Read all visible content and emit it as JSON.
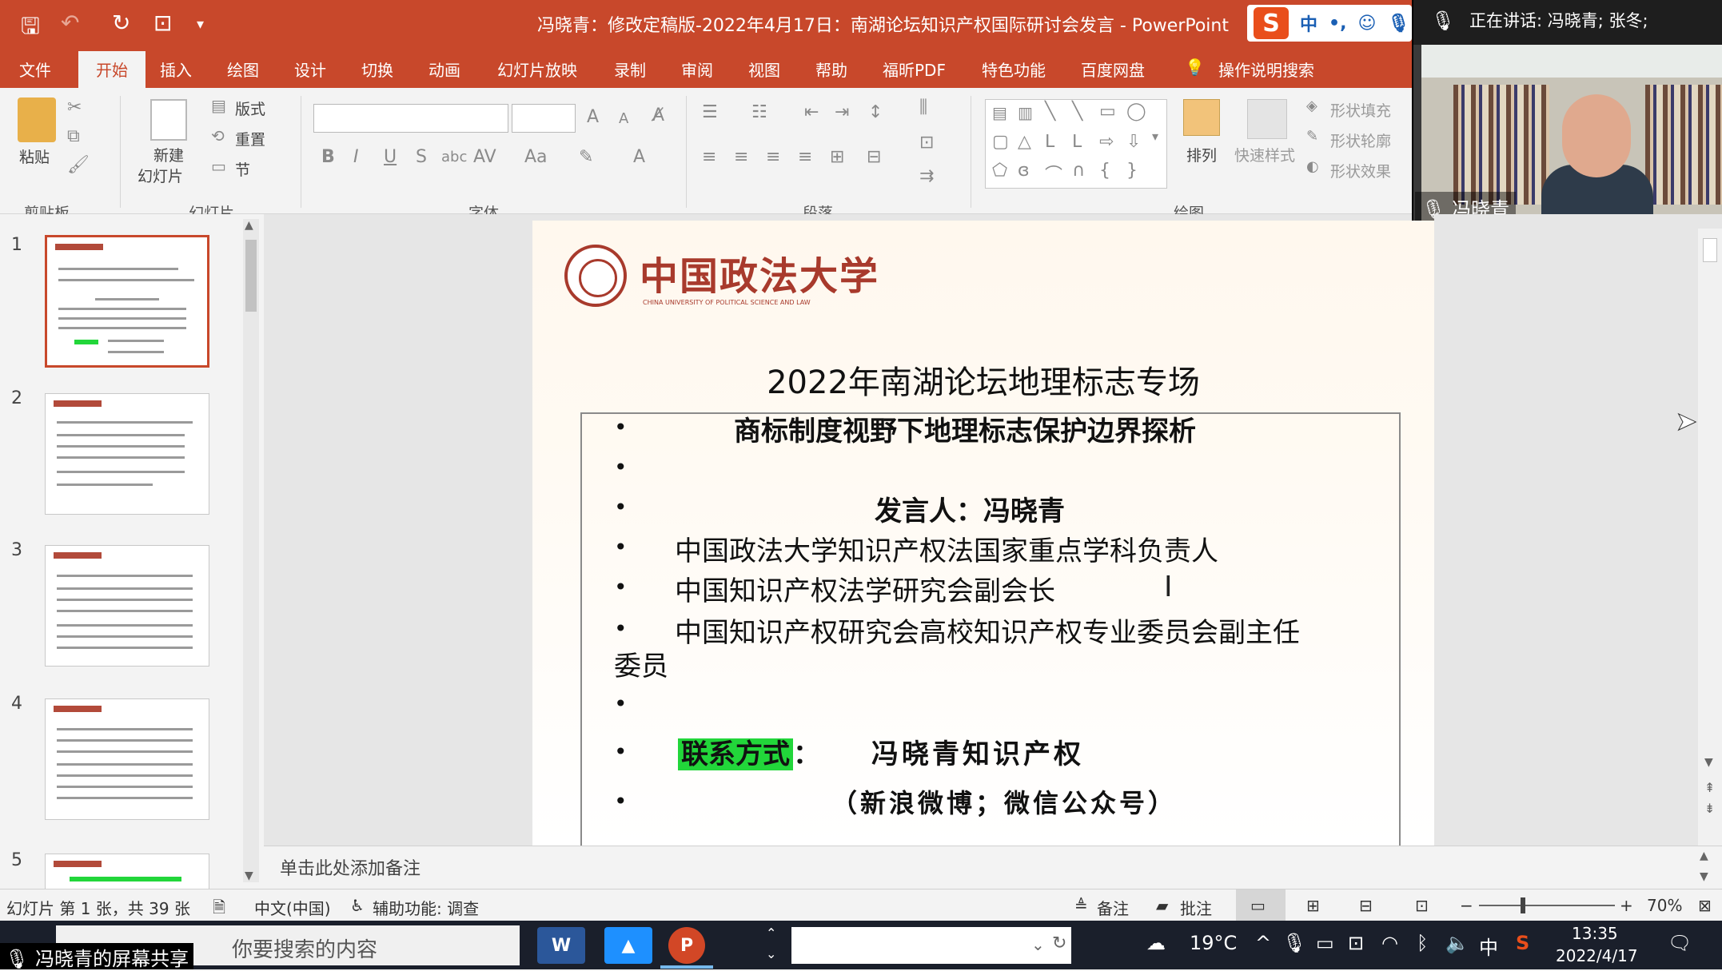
{
  "window": {
    "title": "冯晓青：修改定稿版-2022年4月17日：南湖论坛知识产权国际研讨会发言 - PowerPoint"
  },
  "tabs": [
    "文件",
    "开始",
    "插入",
    "绘图",
    "设计",
    "切换",
    "动画",
    "幻灯片放映",
    "录制",
    "审阅",
    "视图",
    "帮助",
    "福昕PDF",
    "特色功能",
    "百度网盘"
  ],
  "active_tab": "开始",
  "tell_me": "操作说明搜索",
  "ime": {
    "mode": "中"
  },
  "ribbon": {
    "clipboard": {
      "paste": "粘贴",
      "group": "剪贴板"
    },
    "slides": {
      "new_slide_1": "新建",
      "new_slide_2": "幻灯片",
      "layout": "版式",
      "reset": "重置",
      "section": "节",
      "group": "幻灯片"
    },
    "font": {
      "group": "字体"
    },
    "paragraph": {
      "group": "段落"
    },
    "drawing": {
      "arrange": "排列",
      "quick_styles": "快速样式",
      "shape_fill": "形状填充",
      "shape_outline": "形状轮廓",
      "shape_effects": "形状效果",
      "group": "绘图"
    }
  },
  "video": {
    "speaking": "正在讲话: 冯晓青; 张冬;",
    "name": "冯晓青"
  },
  "thumbnails": [
    {
      "num": "1"
    },
    {
      "num": "2"
    },
    {
      "num": "3"
    },
    {
      "num": "4"
    },
    {
      "num": "5"
    }
  ],
  "slide": {
    "logo_cn": "中国政法大学",
    "logo_en": "CHINA UNIVERSITY OF POLITICAL SCIENCE AND LAW",
    "title": "2022年南湖论坛地理标志专场",
    "subtitle": "商标制度视野下地理标志保护边界探析",
    "speaker": "发言人：冯晓青",
    "role1": "中国政法大学知识产权法国家重点学科负责人",
    "role2": "中国知识产权法学研究会副会长",
    "role3a": "中国知识产权研究会高校知识产权专业委员会副主任",
    "role3b": "委员",
    "contact_label": "联系方式",
    "contact_colon": "：",
    "contact_value": "冯晓青知识产权",
    "contact_note": "（新浪微博；微信公众号）",
    "bullet": "•"
  },
  "notes_placeholder": "单击此处添加备注",
  "status": {
    "slide_info": "幻灯片 第 1 张，共 39 张",
    "language": "中文(中国)",
    "accessibility": "辅助功能: 调查",
    "notes": "备注",
    "comments": "批注",
    "zoom": "70%"
  },
  "taskbar": {
    "share_label": "冯晓青的屏幕共享",
    "search_placeholder": "你要搜索的内容",
    "weather": "19°C",
    "ime": "中",
    "time": "13:35",
    "date": "2022/4/17"
  },
  "colors": {
    "accent": "#c8482b",
    "highlight": "#22d63a"
  }
}
